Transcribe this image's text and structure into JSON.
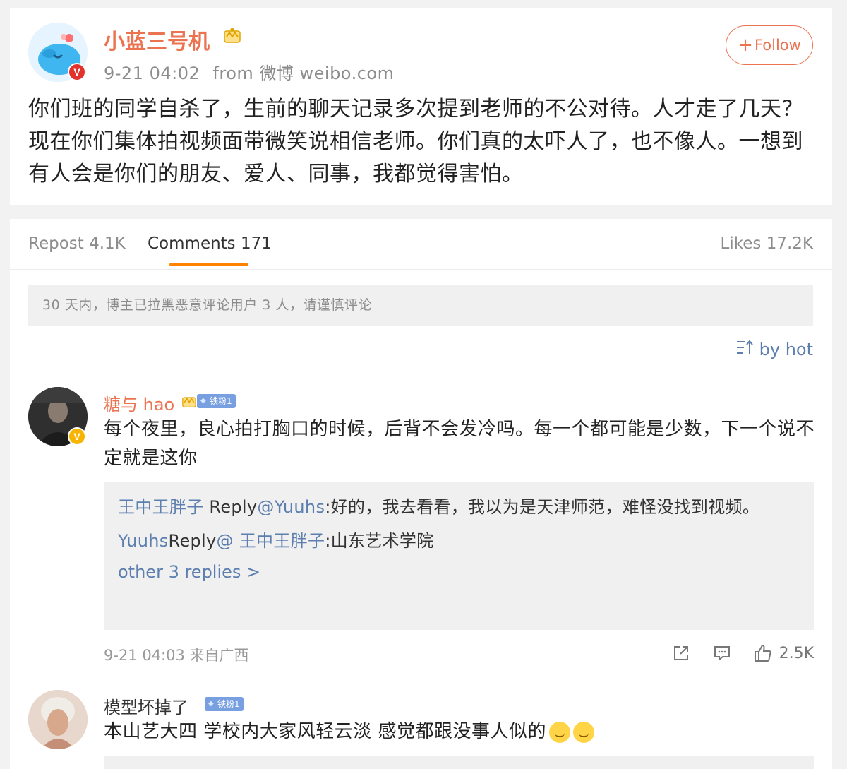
{
  "post": {
    "username": "小蓝三号机",
    "time": "9-21 04:02",
    "source": "from 微博 weibo.com",
    "follow_label": "Follow",
    "text": "你们班的同学自杀了，生前的聊天记录多次提到老师的不公对待。人才走了几天？现在你们集体拍视频面带微笑说相信老师。你们真的太吓人了，也不像人。一想到有人会是你们的朋友、爱人、同事，我都觉得害怕。",
    "verified_badge": "V"
  },
  "tabs": {
    "repost": "Repost 4.1K",
    "comments": "Comments 171",
    "likes": "Likes 17.2K"
  },
  "notice": "30 天内，博主已拉黑恶意评论用户 3 人，请谨慎评论",
  "sort_label": "by hot",
  "comments": [
    {
      "username": "糖与 hao",
      "fan_badge": "铁粉1",
      "verified_badge": "V",
      "text": "每个夜里，良心拍打胸口的时候，后背不会发冷吗。每一个都可能是少数，下一个说不定就是这你",
      "replies": [
        {
          "user": "王中王胖子",
          "reply_word": " Reply",
          "target": "@Yuuhs",
          "text": ":好的，我去看看，我以为是天津师范，难怪没找到视频。"
        },
        {
          "user": "Yuuhs",
          "reply_word": "Reply",
          "target": "@ 王中王胖子",
          "text": ":山东艺术学院"
        }
      ],
      "more_replies": "other 3 replies >",
      "time": "9-21 04:03 来自广西",
      "likes": "2.5K"
    },
    {
      "username": "模型坏掉了",
      "fan_badge": "铁粉1",
      "text": "本山艺大四 学校内大家风轻云淡 感觉都跟没事人似的"
    }
  ],
  "colors": {
    "accent_orange": "#eb7350",
    "link_blue": "#5d7faf",
    "tab_underline": "#ff8200"
  },
  "icons": [
    "crown-icon",
    "plus-icon",
    "sort-icon",
    "share-icon",
    "comment-icon",
    "like-icon",
    "emoji-icon"
  ]
}
